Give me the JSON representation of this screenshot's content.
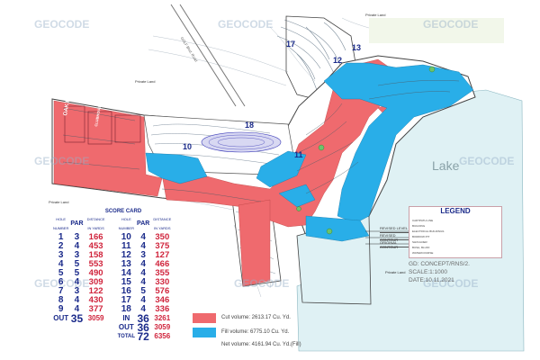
{
  "watermark": "GEOCODE",
  "map_labels": {
    "lake": "Lake",
    "private_land": "Private Land",
    "oak_park": "OAK PARK",
    "clubhouse": "CLUBHOUSE",
    "road": "GOLF Blvd. Road"
  },
  "holes": [
    "10",
    "11",
    "12",
    "13",
    "17",
    "18"
  ],
  "scorecard": {
    "title": "SCORE CARD",
    "header": [
      "HOLE NUMBER",
      "PAR",
      "DISTANCE IN YARDS",
      "HOLE NUMBER",
      "PAR",
      "DISTANCE IN YARDS"
    ],
    "front": [
      {
        "hole": "1",
        "par": "3",
        "yds": "166"
      },
      {
        "hole": "2",
        "par": "4",
        "yds": "453"
      },
      {
        "hole": "3",
        "par": "3",
        "yds": "158"
      },
      {
        "hole": "4",
        "par": "5",
        "yds": "553"
      },
      {
        "hole": "5",
        "par": "5",
        "yds": "490"
      },
      {
        "hole": "6",
        "par": "4",
        "yds": "309"
      },
      {
        "hole": "7",
        "par": "3",
        "yds": "122"
      },
      {
        "hole": "8",
        "par": "4",
        "yds": "430"
      },
      {
        "hole": "9",
        "par": "4",
        "yds": "377"
      }
    ],
    "back": [
      {
        "hole": "10",
        "par": "4",
        "yds": "350"
      },
      {
        "hole": "11",
        "par": "4",
        "yds": "375"
      },
      {
        "hole": "12",
        "par": "3",
        "yds": "127"
      },
      {
        "hole": "13",
        "par": "4",
        "yds": "466"
      },
      {
        "hole": "14",
        "par": "4",
        "yds": "355"
      },
      {
        "hole": "15",
        "par": "4",
        "yds": "330"
      },
      {
        "hole": "16",
        "par": "5",
        "yds": "576"
      },
      {
        "hole": "17",
        "par": "4",
        "yds": "346"
      },
      {
        "hole": "18",
        "par": "4",
        "yds": "336"
      }
    ],
    "out_label": "OUT",
    "out_par": "35",
    "out_yds": "3059",
    "in_label": "IN",
    "in_par": "36",
    "in_yds": "3261",
    "out2_label": "OUT",
    "out2_par": "36",
    "out2_yds": "3059",
    "total_label": "TOTAL",
    "total_par": "72",
    "total_yds": "6356"
  },
  "legend": {
    "title": "LEGEND",
    "items": [
      "CARTPATH LINE",
      "BUILDING",
      "ELECTRICAL BUILDINGS",
      "BORROW PIT",
      "SHOULDER",
      "BUSH, BLUFF",
      "WATERCOURSE"
    ]
  },
  "contour_labels": [
    "REVISED LEVEL",
    "REVISED CONTOUR",
    "ORIGINAL CONTOUR"
  ],
  "drawing_info": [
    "GD: CONCEPT/RNS/2.",
    "SCALE:1:1000",
    "DATE:10.11.2021"
  ],
  "volumes": {
    "cut": "Cut volume: 2613.17 Cu. Yd.",
    "fill": "Fill volume: 6775.10 Cu. Yd.",
    "net": "Net volume: 4161.94 Cu. Yd.(Fill)"
  },
  "colors": {
    "cut": "#ef6a6e",
    "fill": "#29aee8",
    "lake": "#dff1f4",
    "contour": "#8a9aa8",
    "hole_text": "#1a2a8a",
    "yards_text": "#d0243c"
  }
}
